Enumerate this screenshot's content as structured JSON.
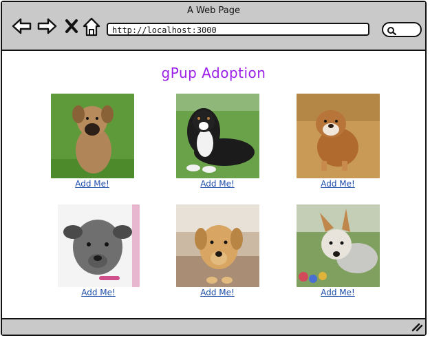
{
  "window": {
    "title": "A Web Page"
  },
  "browser": {
    "url": "http://localhost:3000"
  },
  "page": {
    "title": "gPup Adoption"
  },
  "pups": [
    {
      "action": "Add Me!"
    },
    {
      "action": "Add Me!"
    },
    {
      "action": "Add Me!"
    },
    {
      "action": "Add Me!"
    },
    {
      "action": "Add Me!"
    },
    {
      "action": "Add Me!"
    }
  ],
  "colors": {
    "title": "#9b1fe8",
    "link": "#1e4ea8",
    "chrome": "#c9c9c9"
  }
}
